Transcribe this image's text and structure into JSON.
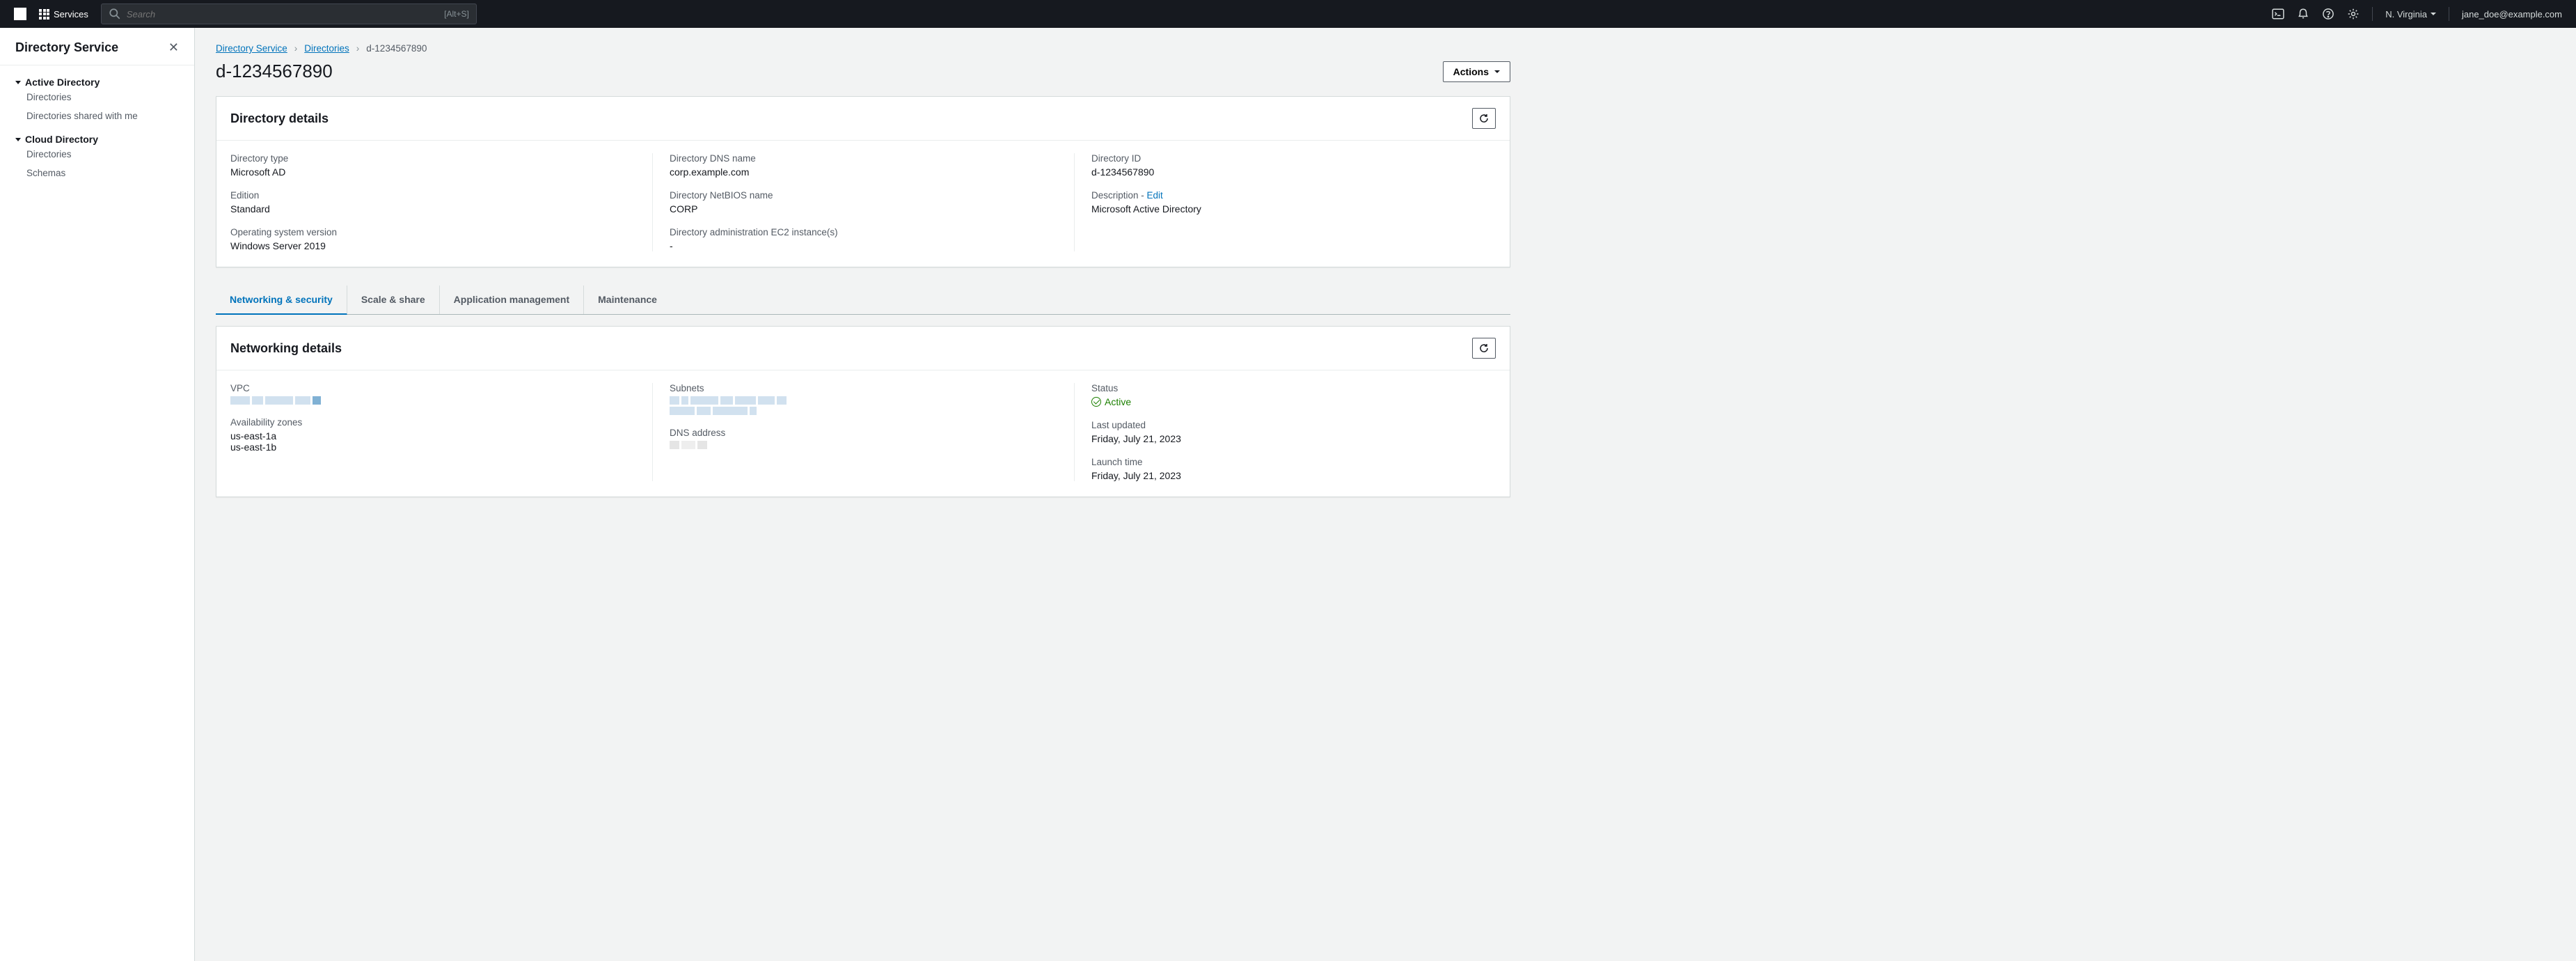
{
  "topnav": {
    "services_label": "Services",
    "search_placeholder": "Search",
    "search_shortcut": "[Alt+S]",
    "region": "N. Virginia",
    "user": "jane_doe@example.com"
  },
  "sidebar": {
    "title": "Directory Service",
    "sections": [
      {
        "title": "Active Directory",
        "links": [
          "Directories",
          "Directories shared with me"
        ]
      },
      {
        "title": "Cloud Directory",
        "links": [
          "Directories",
          "Schemas"
        ]
      }
    ]
  },
  "breadcrumbs": {
    "root": "Directory Service",
    "mid": "Directories",
    "current": "d-1234567890"
  },
  "page": {
    "title": "d-1234567890",
    "actions_label": "Actions"
  },
  "directory_details": {
    "panel_title": "Directory details",
    "col1": {
      "type_label": "Directory type",
      "type_value": "Microsoft AD",
      "edition_label": "Edition",
      "edition_value": "Standard",
      "os_label": "Operating system version",
      "os_value": "Windows Server 2019"
    },
    "col2": {
      "dns_label": "Directory DNS name",
      "dns_value": "corp.example.com",
      "netbios_label": "Directory NetBIOS name",
      "netbios_value": "CORP",
      "admin_label": "Directory administration EC2 instance(s)",
      "admin_value": "-"
    },
    "col3": {
      "id_label": "Directory ID",
      "id_value": "d-1234567890",
      "desc_label": "Description - ",
      "desc_edit": "Edit",
      "desc_value": "Microsoft Active Directory"
    }
  },
  "tabs": {
    "t0": "Networking & security",
    "t1": "Scale & share",
    "t2": "Application management",
    "t3": "Maintenance"
  },
  "networking_details": {
    "panel_title": "Networking details",
    "col1": {
      "vpc_label": "VPC",
      "az_label": "Availability zones",
      "az_value_1": "us-east-1a",
      "az_value_2": "us-east-1b"
    },
    "col2": {
      "subnets_label": "Subnets",
      "dns_addr_label": "DNS address"
    },
    "col3": {
      "status_label": "Status",
      "status_value": "Active",
      "updated_label": "Last updated",
      "updated_value": "Friday, July 21, 2023",
      "launch_label": "Launch time",
      "launch_value": "Friday, July 21, 2023"
    }
  }
}
